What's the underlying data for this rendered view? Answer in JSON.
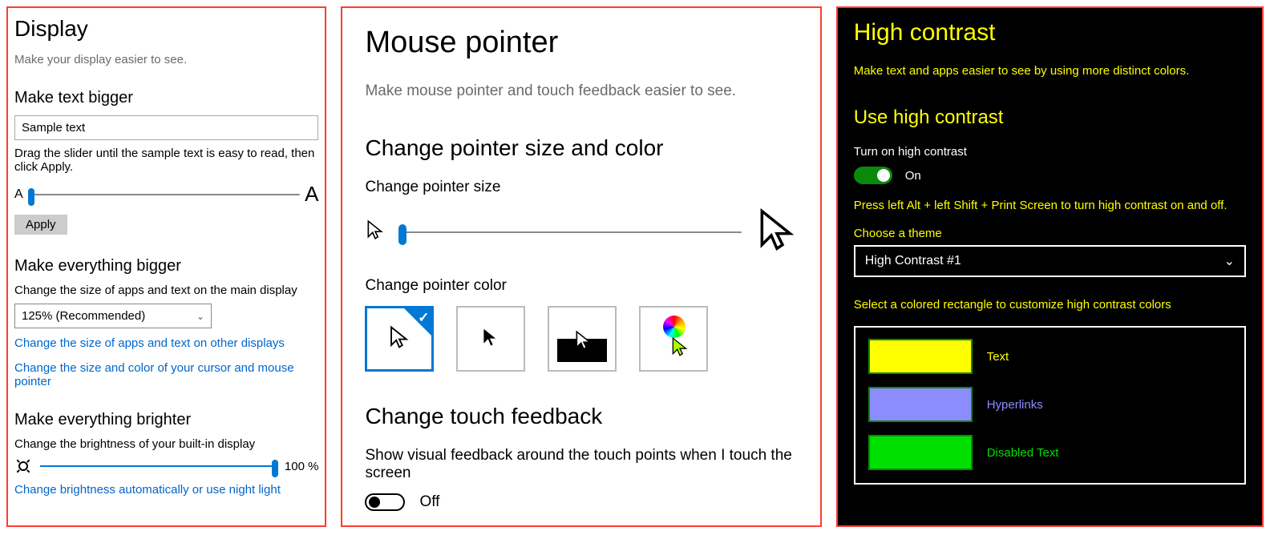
{
  "display": {
    "title": "Display",
    "subtitle": "Make your display easier to see.",
    "text_bigger": {
      "heading": "Make text bigger",
      "sample": "Sample text",
      "note": "Drag the slider until the sample text is easy to read, then click Apply.",
      "small_a": "A",
      "big_a": "A",
      "apply": "Apply"
    },
    "everything_bigger": {
      "heading": "Make everything bigger",
      "note": "Change the size of apps and text on the main display",
      "selected_scale": "125% (Recommended)",
      "link_other_displays": "Change the size of apps and text on other displays",
      "link_cursor": "Change the size and color of your cursor and mouse pointer"
    },
    "brighter": {
      "heading": "Make everything brighter",
      "note": "Change the brightness of your built-in display",
      "value": "100 %",
      "link_night": "Change brightness automatically or use night light"
    }
  },
  "mouse": {
    "title": "Mouse pointer",
    "subtitle": "Make mouse pointer and touch feedback easier to see.",
    "size_color_heading": "Change pointer size and color",
    "size_label": "Change pointer size",
    "color_label": "Change pointer color",
    "touch_heading": "Change touch feedback",
    "touch_text": "Show visual feedback around the touch points when I touch the screen",
    "touch_state": "Off"
  },
  "hc": {
    "title": "High contrast",
    "subtitle": "Make text and apps easier to see by using more distinct colors.",
    "use_heading": "Use high contrast",
    "turn_on": "Turn on high contrast",
    "state": "On",
    "shortcut": "Press left Alt + left Shift + Print Screen to turn high contrast on and off.",
    "theme_label": "Choose a theme",
    "theme_selected": "High Contrast #1",
    "customize": "Select a colored rectangle to customize high contrast colors",
    "swatches": [
      {
        "label": "Text",
        "color": "#ffff00",
        "label_color": "#ffff00"
      },
      {
        "label": "Hyperlinks",
        "color": "#8c8cff",
        "label_color": "#8c8cff"
      },
      {
        "label": "Disabled Text",
        "color": "#00e000",
        "label_color": "#00e000"
      }
    ]
  }
}
